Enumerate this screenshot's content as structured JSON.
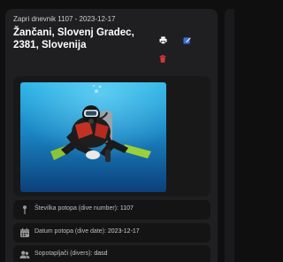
{
  "entry": {
    "subtitle": "Zapri dnevnik 1107 - 2023-12-17",
    "title": "Žančani, Slovenj Gradec, 2381, Slovenija"
  },
  "actions": {
    "print_icon": "printer-icon",
    "edit_icon": "edit-icon",
    "delete_icon": "trash-icon",
    "edit_color": "#3b6fd8",
    "delete_color": "#d9353b"
  },
  "photo": {
    "alt": "diver-photo"
  },
  "fields": [
    {
      "icon": "pin-icon",
      "label": "Številka potopa (dive number):",
      "value": "1107"
    },
    {
      "icon": "calendar-icon",
      "label": "Datum potopa (dive date):",
      "value": "2023-12-17"
    },
    {
      "icon": "users-icon",
      "label": "Sopotapljači (divers):",
      "value": "dasd"
    }
  ]
}
